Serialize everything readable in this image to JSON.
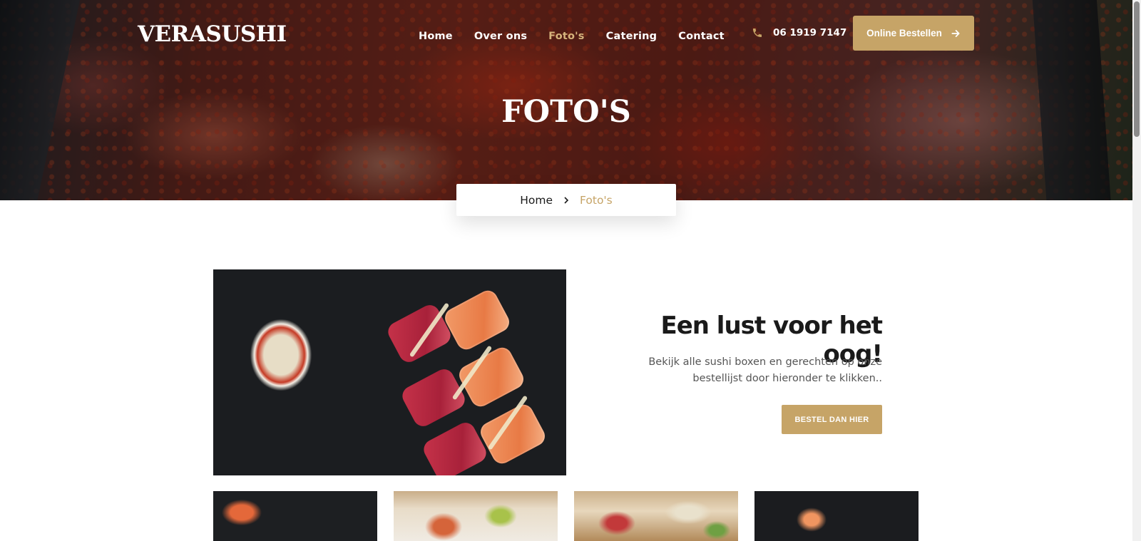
{
  "header": {
    "logo": "VERASUSHI",
    "nav": [
      {
        "label": "Home",
        "active": false
      },
      {
        "label": "Over ons",
        "active": false
      },
      {
        "label": "Foto's",
        "active": true
      },
      {
        "label": "Catering",
        "active": false
      },
      {
        "label": "Contact",
        "active": false
      }
    ],
    "phone": "06 1919 7147",
    "phone_icon": "phone-icon",
    "order_button": "Online Bestellen",
    "order_button_icon": "arrow-right-icon"
  },
  "hero": {
    "title": "FOTO'S"
  },
  "breadcrumb": {
    "home": "Home",
    "separator_icon": "chevron-right-icon",
    "current": "Foto's"
  },
  "intro": {
    "heading": "Een lust voor het oog!",
    "text": "Bekijk alle sushi boxen en gerechten op onze bestellijst door hieronder te klikken..",
    "button": "BESTEL DAN HIER"
  },
  "colors": {
    "accent": "#c6a467",
    "active_nav": "#d5b37c",
    "text_dark": "#1a1a1a",
    "text_muted": "#555555"
  }
}
